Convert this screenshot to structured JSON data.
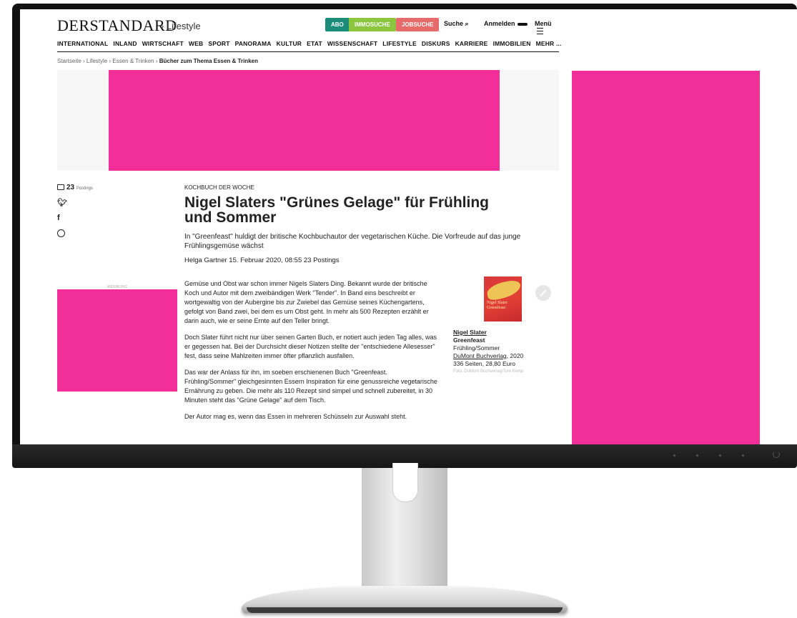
{
  "header": {
    "logo": "DERSTANDARD",
    "section": "› Lifestyle",
    "buttons": [
      {
        "label": "ABO",
        "color": "#1b8c7a"
      },
      {
        "label": "IMMOSUCHE",
        "color": "#8cc63e"
      },
      {
        "label": "JOBSUCHE",
        "color": "#e86b6b"
      }
    ],
    "search_label": "Suche",
    "login_label": "Anmelden",
    "menu_label": "Menü"
  },
  "nav": [
    "INTERNATIONAL",
    "INLAND",
    "WIRTSCHAFT",
    "WEB",
    "SPORT",
    "PANORAMA",
    "KULTUR",
    "ETAT",
    "WISSENSCHAFT",
    "LIFESTYLE",
    "DISKURS",
    "KARRIERE",
    "IMMOBILIEN",
    "MEHR ..."
  ],
  "breadcrumb": {
    "path": "Startseite › Lifestyle › Essen & Trinken › ",
    "current": "Bücher zum Thema Essen & Trinken"
  },
  "share": {
    "postings_count": "23",
    "postings_label": "Postings"
  },
  "ad_label": "WERBUNG",
  "article": {
    "kicker": "KOCHBUCH DER WOCHE",
    "headline": "Nigel Slaters \"Grünes Gelage\" für Frühling und Sommer",
    "lead": "In \"Greenfeast\" huldigt der britische Kochbuchautor der vegetarischen Küche. Die Vorfreude auf das junge Frühlingsgemüse wächst",
    "byline": "Helga Gartner  15. Februar 2020, 08:55  23 Postings",
    "paragraphs": [
      "Gemüse und Obst war schon immer Nigels Slaters Ding. Bekannt wurde der britische Koch und Autor mit dem zweibändigen Werk \"Tender\". In Band eins beschreibt er wortgewaltig von der Aubergine bis zur Zwiebel das Gemüse seines Küchengartens, gefolgt von Band zwei, bei dem es um Obst geht. In mehr als 500 Rezepten erzählt er darin auch, wie er seine Ernte auf den Teller bringt.",
      "Doch Slater führt nicht nur über seinen Garten Buch, er notiert auch jeden Tag alles, was er gegessen hat. Bei der Durchsicht dieser Notizen stellte der \"entschiedene Allesesser\" fest, dass seine Mahlzeiten immer öfter pflanzlich ausfallen.",
      "Das war der Anlass für ihn, im soeben erschienenen Buch \"Greenfeast. Frühling/Sommer\" gleichgesinnten Essern Inspiration für eine genussreiche vegetarische Ernährung zu geben. Die mehr als 110 Rezept sind simpel und schnell zubereitet, in 30 Minuten steht das \"Grüne Gelage\" auf dem Tisch.",
      "Der Autor mag es, wenn das Essen in mehreren Schüsseln zur Auswahl steht."
    ]
  },
  "book": {
    "cover_text": "Nigel Slater Greenfeast",
    "author": "Nigel Slater",
    "title": "Greenfeast",
    "subtitle": "Frühling/Sommer",
    "publisher": "DuMont Buchverlag",
    "year": ", 2020",
    "details": "336 Seiten, 28,80 Euro",
    "credit": "Foto: DuMont Buchverlag/Tom Kemp"
  },
  "colors": {
    "ad_pink": "#f22e98"
  }
}
